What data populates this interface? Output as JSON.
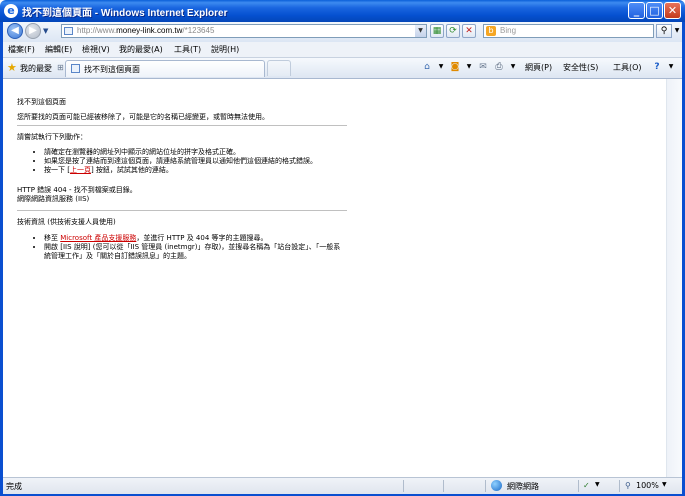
{
  "window": {
    "title": "找不到這個頁面 - Windows Internet Explorer",
    "icon": "ie-logo-icon",
    "controls": [
      "minimize-icon",
      "maximize-icon",
      "close-icon"
    ]
  },
  "address_bar": {
    "url_prefix": "http://www.",
    "url_domain": "money-link.com.tw",
    "url_suffix": "/*123645",
    "search_placeholder": "Bing"
  },
  "menu": {
    "items": [
      "檔案(F)",
      "編輯(E)",
      "檢視(V)",
      "我的最愛(A)",
      "工具(T)",
      "說明(H)"
    ]
  },
  "favorites_bar": {
    "favorites_label": "我的最愛",
    "tab_label": "找不到這個頁面",
    "commands": [
      "網頁(P)",
      "安全性(S)",
      "工具(O)"
    ]
  },
  "page": {
    "heading": "找不到這個頁面",
    "desc": "您所要找的頁面可能已經被移除了，可能是它的名稱已經變更，或暫時無法使用。",
    "try_heading": "請嘗試執行下列動作：",
    "bullet1": "請確定在瀏覽器的網址列中顯示的網站位址的拼字及格式正確。",
    "bullet2": "如果您是按了連結而到達這個頁面，請連絡系統管理員以通知他們這個連結的格式錯誤。",
    "bullet3_pre": "按一下 [",
    "bullet3_link": "上一頁",
    "bullet3_post": "] 按鈕，試試其他的連結。",
    "error_line": "HTTP 錯誤 404 - 找不到檔案或目錄。",
    "server_line": "網際網路資訊服務 (IIS)",
    "tech_heading": "技術資訊 (供技術支援人員使用)",
    "tech1_pre": "移至 ",
    "tech1_link": "Microsoft 產品支援服務",
    "tech1_post": "，並進行 HTTP 及 404 等字的主題搜尋。",
    "tech2": "開啟 [IIS 說明] (您可以從「IIS 管理員 (inetmgr)」存取)，並搜尋名稱為「站台設定」、「一般系統管理工作」及「關於自訂錯誤訊息」的主題。"
  },
  "status_bar": {
    "status": "完成",
    "zone": "網際網路",
    "zoom": "100%"
  },
  "colors": {
    "titlebar": "#0550d0",
    "link": "#cc0000"
  }
}
